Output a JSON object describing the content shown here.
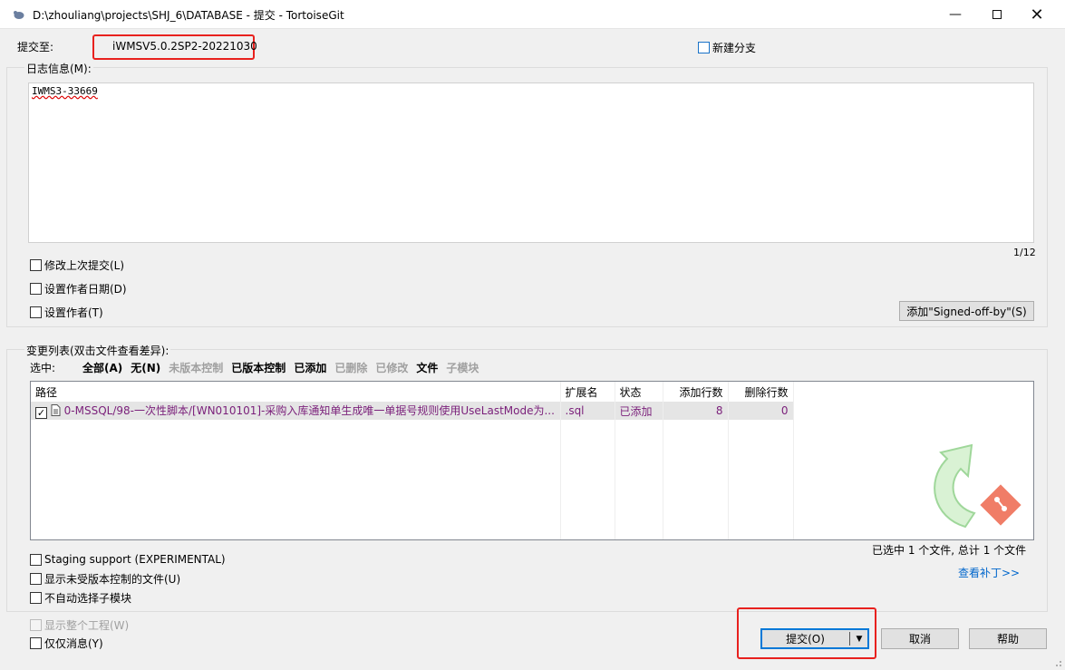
{
  "window": {
    "title": "D:\\zhouliang\\projects\\SHJ_6\\DATABASE - 提交 - TortoiseGit",
    "minimize_icon": "minimize-icon",
    "maximize_icon": "maximize-icon",
    "close_icon": "close-icon"
  },
  "commit_to": {
    "label": "提交至:",
    "branch": "iWMSV5.0.2SP2-20221030",
    "new_branch_label": "新建分支"
  },
  "log": {
    "group_label": "日志信息(M):",
    "message": "IWMS3-33669",
    "counter": "1/12",
    "options": [
      {
        "label": "修改上次提交(L)",
        "checked": false
      },
      {
        "label": "设置作者日期(D)",
        "checked": false
      },
      {
        "label": "设置作者(T)",
        "checked": false
      }
    ],
    "signed_off_button": "添加\"Signed-off-by\"(S)"
  },
  "changes": {
    "group_label": "变更列表(双击文件查看差异):",
    "select_label": "选中:",
    "filters": [
      {
        "label": "全部(A)",
        "enabled": true
      },
      {
        "label": "无(N)",
        "enabled": true
      },
      {
        "label": "未版本控制",
        "enabled": false
      },
      {
        "label": "已版本控制",
        "enabled": true
      },
      {
        "label": "已添加",
        "enabled": true
      },
      {
        "label": "已删除",
        "enabled": false
      },
      {
        "label": "已修改",
        "enabled": false
      },
      {
        "label": "文件",
        "enabled": true
      },
      {
        "label": "子模块",
        "enabled": false
      }
    ],
    "columns": [
      "路径",
      "扩展名",
      "状态",
      "添加行数",
      "删除行数"
    ],
    "rows": [
      {
        "checked": true,
        "path": "0-MSSQL/98-一次性脚本/[WN010101]-采购入库通知单生成唯一单据号规则使用UseLastMode为...",
        "ext": ".sql",
        "status": "已添加",
        "added": "8",
        "deleted": "0"
      }
    ],
    "summary": "已选中 1 个文件, 总计 1 个文件",
    "view_patch_link": "查看补丁>>"
  },
  "bottom_options": [
    {
      "label": "Staging support (EXPERIMENTAL)",
      "checked": false,
      "enabled": true
    },
    {
      "label": "显示未受版本控制的文件(U)",
      "checked": false,
      "enabled": true
    },
    {
      "label": "不自动选择子模块",
      "checked": false,
      "enabled": true
    },
    {
      "label": "显示整个工程(W)",
      "checked": false,
      "enabled": false
    },
    {
      "label": "仅仅消息(Y)",
      "checked": false,
      "enabled": true
    }
  ],
  "buttons": {
    "commit": "提交(O)",
    "cancel": "取消",
    "help": "帮助"
  },
  "colors": {
    "highlight_red": "#e8211e",
    "file_text_purple": "#7a1f7a",
    "link_blue": "#0066cc",
    "logo_green": "#4caf50"
  }
}
